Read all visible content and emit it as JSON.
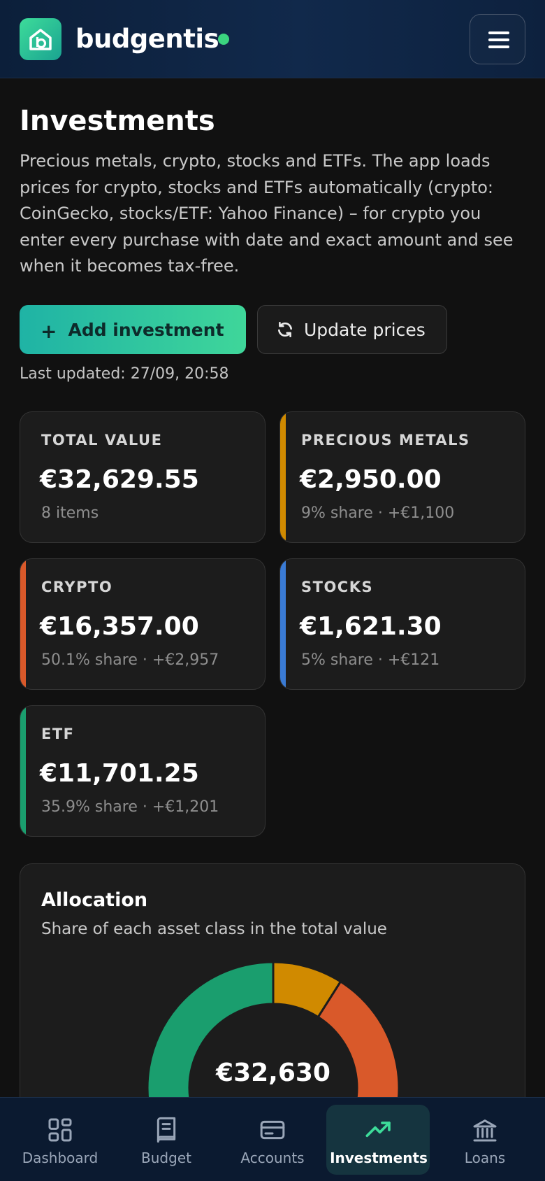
{
  "header": {
    "brand": "budgentis",
    "colors": {
      "accent": "#3ddc9a",
      "status": "#3bd47f"
    }
  },
  "page": {
    "title": "Investments",
    "description": "Precious metals, crypto, stocks and ETFs. The app loads prices for crypto, stocks and ETFs automatically (crypto: CoinGecko, stocks/ETF: Yahoo Finance) – for crypto you enter every purchase with date and exact amount and see when it becomes tax-free."
  },
  "actions": {
    "add_label": "Add investment",
    "add_icon": "plus-icon",
    "update_label": "Update prices",
    "update_icon": "refresh-icon",
    "last_updated": "Last updated: 27/09, 20:58"
  },
  "cards": [
    {
      "label": "TOTAL VALUE",
      "value": "€32,629.55",
      "sub": "8 items",
      "accent": ""
    },
    {
      "label": "PRECIOUS METALS",
      "value": "€2,950.00",
      "sub": "9% share · +€1,100",
      "accent": "#d08a00"
    },
    {
      "label": "CRYPTO",
      "value": "€16,357.00",
      "sub": "50.1% share · +€2,957",
      "accent": "#d9592a"
    },
    {
      "label": "STOCKS",
      "value": "€1,621.30",
      "sub": "5% share · +€121",
      "accent": "#3a7bd5"
    },
    {
      "label": "ETF",
      "value": "€11,701.25",
      "sub": "35.9% share · +€1,201",
      "accent": "#1a9e6e"
    }
  ],
  "allocation": {
    "title": "Allocation",
    "subtitle": "Share of each asset class in the total value",
    "center_value": "€32,630"
  },
  "chart_data": {
    "type": "pie",
    "categories": [
      "Precious metals",
      "Crypto",
      "Stocks",
      "ETF"
    ],
    "values": [
      9,
      50.1,
      5,
      35.9
    ],
    "colors": [
      "#d08a00",
      "#d9592a",
      "#3a7bd5",
      "#1a9e6e"
    ],
    "title": "Allocation",
    "subtitle": "Share of each asset class in the total value",
    "center_label": "€32,630"
  },
  "nav": {
    "items": [
      {
        "label": "Dashboard",
        "icon": "dashboard-icon",
        "active": false
      },
      {
        "label": "Budget",
        "icon": "book-icon",
        "active": false
      },
      {
        "label": "Accounts",
        "icon": "card-icon",
        "active": false
      },
      {
        "label": "Investments",
        "icon": "trending-up-icon",
        "active": true
      },
      {
        "label": "Loans",
        "icon": "bank-icon",
        "active": false
      }
    ]
  }
}
